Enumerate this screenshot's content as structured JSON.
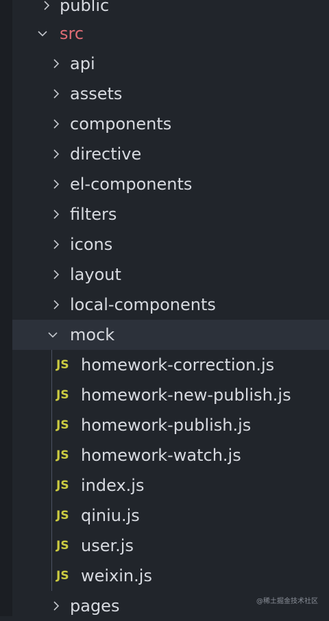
{
  "explorer": {
    "items": [
      {
        "label": "public",
        "expanded": false,
        "kind": "folder"
      },
      {
        "label": "src",
        "expanded": true,
        "kind": "folder"
      },
      {
        "label": "api",
        "expanded": false,
        "kind": "folder"
      },
      {
        "label": "assets",
        "expanded": false,
        "kind": "folder"
      },
      {
        "label": "components",
        "expanded": false,
        "kind": "folder"
      },
      {
        "label": "directive",
        "expanded": false,
        "kind": "folder"
      },
      {
        "label": "el-components",
        "expanded": false,
        "kind": "folder"
      },
      {
        "label": "filters",
        "expanded": false,
        "kind": "folder"
      },
      {
        "label": "icons",
        "expanded": false,
        "kind": "folder"
      },
      {
        "label": "layout",
        "expanded": false,
        "kind": "folder"
      },
      {
        "label": "local-components",
        "expanded": false,
        "kind": "folder"
      },
      {
        "label": "mock",
        "expanded": true,
        "kind": "folder"
      },
      {
        "label": "homework-correction.js",
        "kind": "file",
        "icon": "JS"
      },
      {
        "label": "homework-new-publish.js",
        "kind": "file",
        "icon": "JS"
      },
      {
        "label": "homework-publish.js",
        "kind": "file",
        "icon": "JS"
      },
      {
        "label": "homework-watch.js",
        "kind": "file",
        "icon": "JS"
      },
      {
        "label": "index.js",
        "kind": "file",
        "icon": "JS"
      },
      {
        "label": "qiniu.js",
        "kind": "file",
        "icon": "JS"
      },
      {
        "label": "user.js",
        "kind": "file",
        "icon": "JS"
      },
      {
        "label": "weixin.js",
        "kind": "file",
        "icon": "JS"
      },
      {
        "label": "pages",
        "expanded": false,
        "kind": "folder"
      }
    ]
  },
  "watermark": "@稀土掘金技术社区",
  "colors": {
    "background": "#21252b",
    "selected": "#2c313a",
    "text": "#d7dae0",
    "src_folder": "#e06c75",
    "js_icon": "#cbcb41"
  }
}
